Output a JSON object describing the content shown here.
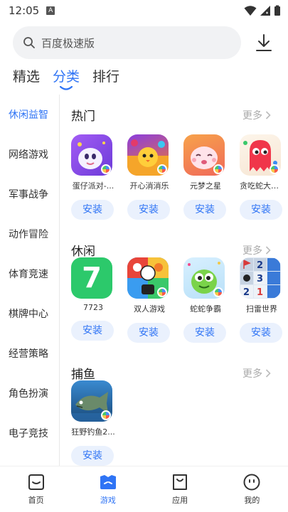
{
  "status_bar": {
    "time": "12:05",
    "notification_letter": "A"
  },
  "search": {
    "placeholder": "百度极速版"
  },
  "top_tabs": [
    {
      "label": "精选",
      "active": false
    },
    {
      "label": "分类",
      "active": true
    },
    {
      "label": "排行",
      "active": false
    }
  ],
  "sidebar": {
    "items": [
      {
        "label": "休闲益智",
        "active": true
      },
      {
        "label": "网络游戏"
      },
      {
        "label": "军事战争"
      },
      {
        "label": "动作冒险"
      },
      {
        "label": "体育竞速"
      },
      {
        "label": "棋牌中心"
      },
      {
        "label": "经营策略"
      },
      {
        "label": "角色扮演"
      },
      {
        "label": "电子竞技"
      }
    ]
  },
  "sections": [
    {
      "title": "热门",
      "more": "更多",
      "apps": [
        {
          "name": "蛋仔派对-...",
          "install": "安装"
        },
        {
          "name": "开心消消乐",
          "install": "安装"
        },
        {
          "name": "元梦之星",
          "install": "安装"
        },
        {
          "name": "贪吃蛇大作战",
          "install": "安装"
        }
      ]
    },
    {
      "title": "休闲",
      "more": "更多",
      "apps": [
        {
          "name": "7723",
          "install": "安装",
          "icon_text": "7"
        },
        {
          "name": "双人游戏",
          "install": "安装"
        },
        {
          "name": "蛇蛇争霸",
          "install": "安装"
        },
        {
          "name": "扫雷世界",
          "install": "安装",
          "icon_text": "2 2 3 1 2"
        }
      ]
    },
    {
      "title": "捕鱼",
      "more": "更多",
      "apps": [
        {
          "name": "狂野钓鱼2...",
          "install": "安装"
        }
      ]
    }
  ],
  "bottom_nav": [
    {
      "label": "首页",
      "icon": "home-icon",
      "active": false
    },
    {
      "label": "游戏",
      "icon": "game-icon",
      "active": true
    },
    {
      "label": "应用",
      "icon": "app-bag-icon",
      "active": false
    },
    {
      "label": "我的",
      "icon": "profile-icon",
      "active": false
    }
  ],
  "colors": {
    "accent": "#2f74f5",
    "install_bg": "#eaf1fd",
    "search_bg": "#f1f2f4"
  }
}
